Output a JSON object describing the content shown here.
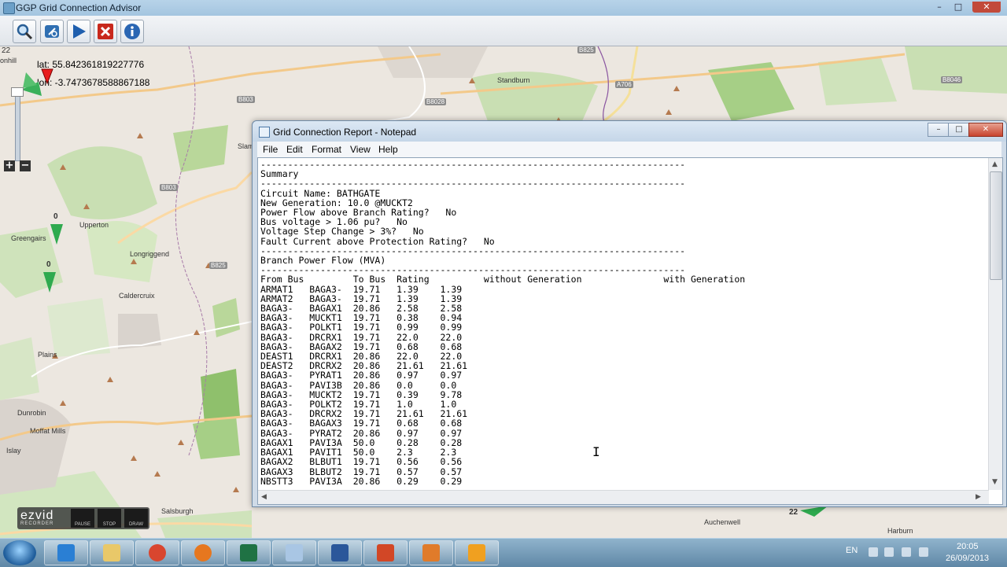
{
  "app": {
    "title": "GGP Grid Connection Advisor",
    "window_controls": {
      "minimize": "–",
      "maximize": "□",
      "close": "✕"
    },
    "toolbar": [
      {
        "name": "search-button",
        "icon": "magnifier-icon"
      },
      {
        "name": "refresh-button",
        "icon": "refresh-icon"
      },
      {
        "name": "run-button",
        "icon": "play-icon"
      },
      {
        "name": "clear-button",
        "icon": "red-x-icon"
      },
      {
        "name": "info-button",
        "icon": "info-icon"
      }
    ]
  },
  "map": {
    "lat_label": "lat: 55.842361819227776",
    "lon_label": "lon: -3.7473678588867188",
    "zoom_level": "22",
    "zoom_in": "+",
    "zoom_out": "−",
    "markers": [
      {
        "label": "0"
      },
      {
        "label": "0"
      },
      {
        "label": "0"
      },
      {
        "label": "22"
      }
    ],
    "places": [
      "Standburn",
      "Upperton",
      "Greengairs",
      "Longriggend",
      "Caldercruix",
      "Plains",
      "Dunrobin",
      "Moffat Mills",
      "Islay",
      "Salsburgh",
      "Harburn",
      "Slam",
      "onhill",
      "Auchenwell"
    ],
    "roads": [
      "B825",
      "B803",
      "B8028",
      "A706",
      "B8046",
      "B803",
      "B825",
      "B803"
    ]
  },
  "notepad": {
    "title": "Grid Connection Report - Notepad",
    "menu": [
      "File",
      "Edit",
      "Format",
      "View",
      "Help"
    ],
    "content": "------------------------------------------------------------------------------\nSummary\n------------------------------------------------------------------------------\nCircuit Name: BATHGATE\nNew Generation: 10.0 @MUCKT2\nPower Flow above Branch Rating?   No\nBus voltage > 1.06 pu?   No\nVoltage Step Change > 3%?   No\nFault Current above Protection Rating?   No\n------------------------------------------------------------------------------\nBranch Power Flow (MVA)\n------------------------------------------------------------------------------\nFrom Bus         To Bus  Rating          without Generation               with Generation\nARMAT1   BAGA3-  19.71   1.39    1.39\nARMAT2   BAGA3-  19.71   1.39    1.39\nBAGA3-   BAGAX1  20.86   2.58    2.58\nBAGA3-   MUCKT1  19.71   0.38    0.94\nBAGA3-   POLKT1  19.71   0.99    0.99\nBAGA3-   DRCRX1  19.71   22.0    22.0\nBAGA3-   BAGAX2  19.71   0.68    0.68\nDEAST1   DRCRX1  20.86   22.0    22.0\nDEAST2   DRCRX2  20.86   21.61   21.61\nBAGA3-   PYRAT1  20.86   0.97    0.97\nBAGA3-   PAVI3B  20.86   0.0     0.0\nBAGA3-   MUCKT2  19.71   0.39    9.78\nBAGA3-   POLKT2  19.71   1.0     1.0\nBAGA3-   DRCRX2  19.71   21.61   21.61\nBAGA3-   BAGAX3  19.71   0.68    0.68\nBAGA3-   PYRAT2  20.86   0.97    0.97\nBAGAX1   PAVI3A  50.0    0.28    0.28\nBAGAX1   PAVIT1  50.0    2.3     2.3\nBAGAX2   BLBUT1  19.71   0.56    0.56\nBAGAX3   BLBUT2  19.71   0.57    0.57\nNBSTT3   PAVI3A  20.86   0.29    0.29",
    "window_controls": {
      "minimize": "–",
      "maximize": "□",
      "close": "✕"
    }
  },
  "ezvid": {
    "logo": "ezvid",
    "sub": "RECORDER",
    "buttons": [
      "PAUSE",
      "STOP",
      "DRAW"
    ]
  },
  "taskbar": {
    "apps": [
      {
        "name": "internet-explorer",
        "color": "#2a7fd4"
      },
      {
        "name": "file-explorer",
        "color": "#e9c869"
      },
      {
        "name": "chrome",
        "color": "#d9462f"
      },
      {
        "name": "firefox",
        "color": "#e6771f"
      },
      {
        "name": "excel",
        "color": "#1f7244"
      },
      {
        "name": "notepad",
        "color": "#a9c6e4"
      },
      {
        "name": "word",
        "color": "#2b579a"
      },
      {
        "name": "powerpoint",
        "color": "#d24726"
      },
      {
        "name": "java",
        "color": "#e07b2a"
      },
      {
        "name": "media",
        "color": "#f0a020"
      }
    ],
    "language": "EN",
    "time": "20:05",
    "date": "26/09/2013"
  }
}
